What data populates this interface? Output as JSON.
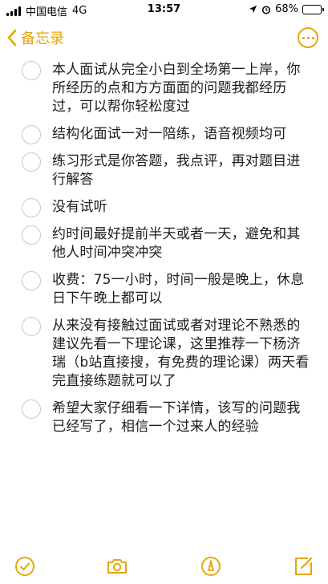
{
  "status_bar": {
    "carrier": "中国电信",
    "network": "4G",
    "time": "13:57",
    "battery_percent": "68%",
    "battery_level": 0.68
  },
  "nav": {
    "back_label": "备忘录"
  },
  "checklist": [
    {
      "text": "本人面试从完全小白到全场第一上岸，你所经历的点和方方面面的问题我都经历过，可以帮你轻松度过"
    },
    {
      "text": "结构化面试一对一陪练，语音视频均可"
    },
    {
      "text": "练习形式是你答题，我点评，再对题目进行解答"
    },
    {
      "text": "没有试听"
    },
    {
      "text": "约时间最好提前半天或者一天，避免和其他人时间冲突冲突"
    },
    {
      "text": "收费：75一小时，时间一般是晚上，休息日下午晚上都可以"
    },
    {
      "text": "从来没有接触过面试或者对理论不熟悉的建议先看一下理论课，这里推荐一下杨济瑞（b站直接搜，有免费的理论课）两天看完直接练题就可以了"
    },
    {
      "text": "希望大家仔细看一下详情，该写的问题我已经写了，相信一个过来人的经验"
    }
  ],
  "colors": {
    "accent": "#e6a50a",
    "circle": "#c7c7cc"
  },
  "icons": [
    "checklist-icon",
    "camera-icon",
    "markup-pen-icon",
    "compose-icon"
  ]
}
